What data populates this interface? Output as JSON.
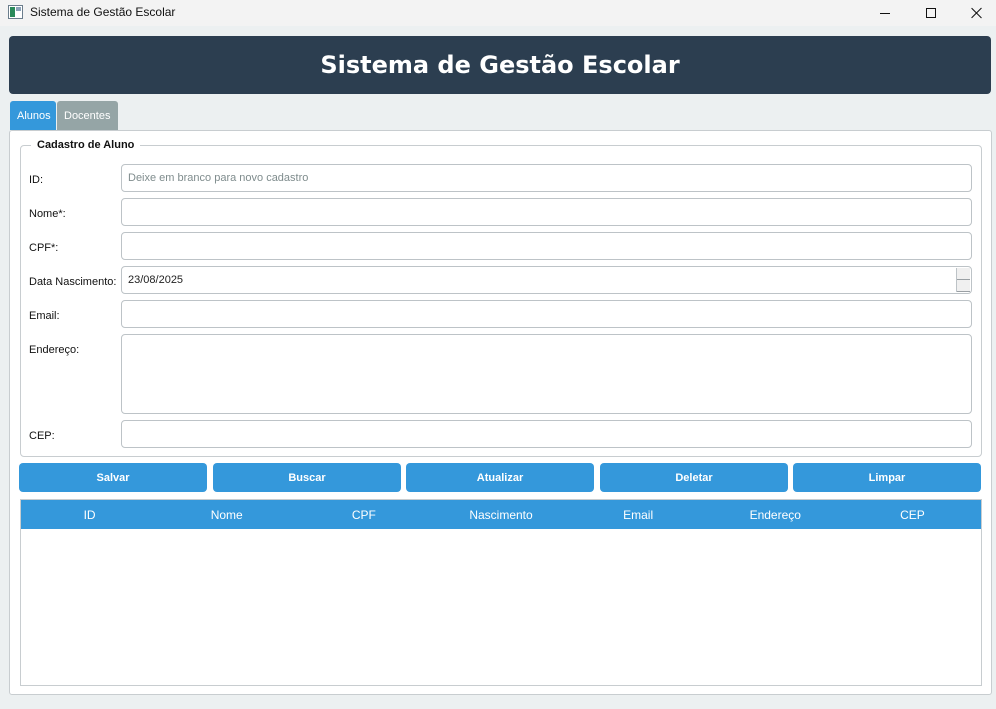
{
  "window": {
    "title": "Sistema de Gestão Escolar"
  },
  "header": {
    "title": "Sistema de Gestão Escolar"
  },
  "tabs": [
    {
      "label": "Alunos",
      "active": true
    },
    {
      "label": "Docentes",
      "active": false
    }
  ],
  "form": {
    "group_title": "Cadastro de Aluno",
    "fields": {
      "id": {
        "label": "ID:",
        "value": "",
        "placeholder": "Deixe em branco para novo cadastro"
      },
      "nome": {
        "label": "Nome*:",
        "value": ""
      },
      "cpf": {
        "label": "CPF*:",
        "value": ""
      },
      "nascimento": {
        "label": "Data Nascimento:",
        "value": "23/08/2025"
      },
      "email": {
        "label": "Email:",
        "value": ""
      },
      "endereco": {
        "label": "Endereço:",
        "value": ""
      },
      "cep": {
        "label": "CEP:",
        "value": ""
      }
    }
  },
  "actions": [
    "Salvar",
    "Buscar",
    "Atualizar",
    "Deletar",
    "Limpar"
  ],
  "table": {
    "columns": [
      "ID",
      "Nome",
      "CPF",
      "Nascimento",
      "Email",
      "Endereço",
      "CEP"
    ],
    "rows": []
  },
  "colors": {
    "header_bg": "#2c3e50",
    "accent": "#3498db",
    "tab_inactive": "#95a5a6",
    "window_bg": "#ecf0f1"
  }
}
